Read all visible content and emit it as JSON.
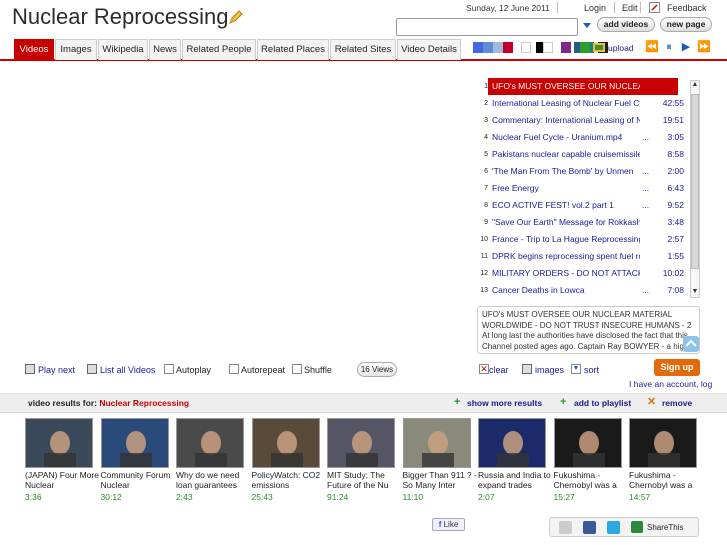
{
  "header": {
    "title": "Nuclear Reprocessing",
    "date": "Sunday, 12 June 2011",
    "links": [
      "Login",
      "Edit",
      "Feedback"
    ],
    "add_videos": "add videos",
    "new_page": "new page"
  },
  "tabs": [
    "Videos",
    "Images",
    "Wikipedia",
    "News",
    "Related People",
    "Related Places",
    "Related Sites",
    "Video Details"
  ],
  "swatches": [
    "#4169e1",
    "#5f8dd3",
    "#a0b8e0",
    "#c0002a",
    "#ffffff",
    "#000000",
    "#ffffff",
    "#7b2a8a",
    "#2a5a8a",
    "#1f7f7f",
    "#1f1f1f",
    "#2aa02a"
  ],
  "upload_label": "upload",
  "playlist": [
    {
      "num": "1",
      "title": "UFO's MUST OVERSEE OUR NUCLEA...",
      "dots": "",
      "dur": "0",
      "selected": true
    },
    {
      "num": "2",
      "title": "International Leasing of Nuclear Fuel Cy...",
      "dots": "",
      "dur": "42:55"
    },
    {
      "num": "3",
      "title": "Commentary: International Leasing of N...",
      "dots": "",
      "dur": "19:51"
    },
    {
      "num": "4",
      "title": "Nuclear Fuel Cycle - Uranium.mp4",
      "dots": "...",
      "dur": "3:05"
    },
    {
      "num": "5",
      "title": "Pakistans nuclear capable cruisemissile...",
      "dots": "",
      "dur": "8:58"
    },
    {
      "num": "6",
      "title": "'The Man From The Bomb' by Unmen",
      "dots": "...",
      "dur": "2:00"
    },
    {
      "num": "7",
      "title": "Free Energy",
      "dots": "...",
      "dur": "6:43"
    },
    {
      "num": "8",
      "title": "ECO ACTIVE FEST! vol.2 part 1",
      "dots": "...",
      "dur": "9:52"
    },
    {
      "num": "9",
      "title": "\"Save Our Earth\" Message for Rokkasho...",
      "dots": "",
      "dur": "3:48"
    },
    {
      "num": "10",
      "title": "France - Trip to La Hague Reprocessing...",
      "dots": "",
      "dur": "2:57"
    },
    {
      "num": "11",
      "title": "DPRK begins reprocessing spent fuel ro...",
      "dots": "",
      "dur": "1:55"
    },
    {
      "num": "12",
      "title": "MILITARY ORDERS - DO NOT ATTACK...",
      "dots": "",
      "dur": "10:02"
    },
    {
      "num": "13",
      "title": "Cancer Deaths in Lowca",
      "dots": "...",
      "dur": "7:08"
    }
  ],
  "description": "UFO's MUST OVERSEE OUR NUCLEAR MATERIAL WORLDWIDE - DO NOT TRUST INSECURE HUMANS - 2 At long last the authorities have disclosed the fact that this Channel posted ages ago. Captain Ray BOWYER - a highly experienced pilot with Aurigny Ai",
  "controls": {
    "play_next": "Play next",
    "list_all": "List all Videos",
    "autoplay": "Autoplay",
    "autorepeat": "Autorepeat",
    "shuffle": "Shuffle",
    "views": "16 Views",
    "clear": "clear",
    "images": "images",
    "sort": "sort",
    "signup": "Sign up",
    "account": "I have an account, log"
  },
  "results": {
    "label": "video results for:",
    "query": "Nuclear Reprocessing",
    "show_more": "show more results",
    "add_playlist": "add to playlist",
    "remove": "remove"
  },
  "videos": [
    {
      "title": "(JAPAN) Four More Nuclear",
      "dur": "3:36",
      "bg": "#3a4a5a"
    },
    {
      "title": "Community Forum Nuclear",
      "dur": "30:12",
      "bg": "#2a4a7a"
    },
    {
      "title": "Why do we need loan guarantees",
      "dur": "2:43",
      "bg": "#4a4a4a"
    },
    {
      "title": "PolicyWatch: CO2 emissions",
      "dur": "25:43",
      "bg": "#5a4a3a"
    },
    {
      "title": "MIT Study: The Future of the Nu",
      "dur": "91:24",
      "bg": "#555566"
    },
    {
      "title": "Bigger Than 911 ? - So Many Inter",
      "dur": "11:10",
      "bg": "#8a8a7a"
    },
    {
      "title": "Russia and India to expand trades",
      "dur": "2:07",
      "bg": "#1a2a6a"
    },
    {
      "title": "Fukushima - Chernobyl was a",
      "dur": "15:27",
      "bg": "#1a1a1a"
    },
    {
      "title": "Fukushima - Chernobyl was a",
      "dur": "14:57",
      "bg": "#1a1a1a"
    }
  ],
  "footer": {
    "like": "Like",
    "sharethis": "ShareThis"
  }
}
